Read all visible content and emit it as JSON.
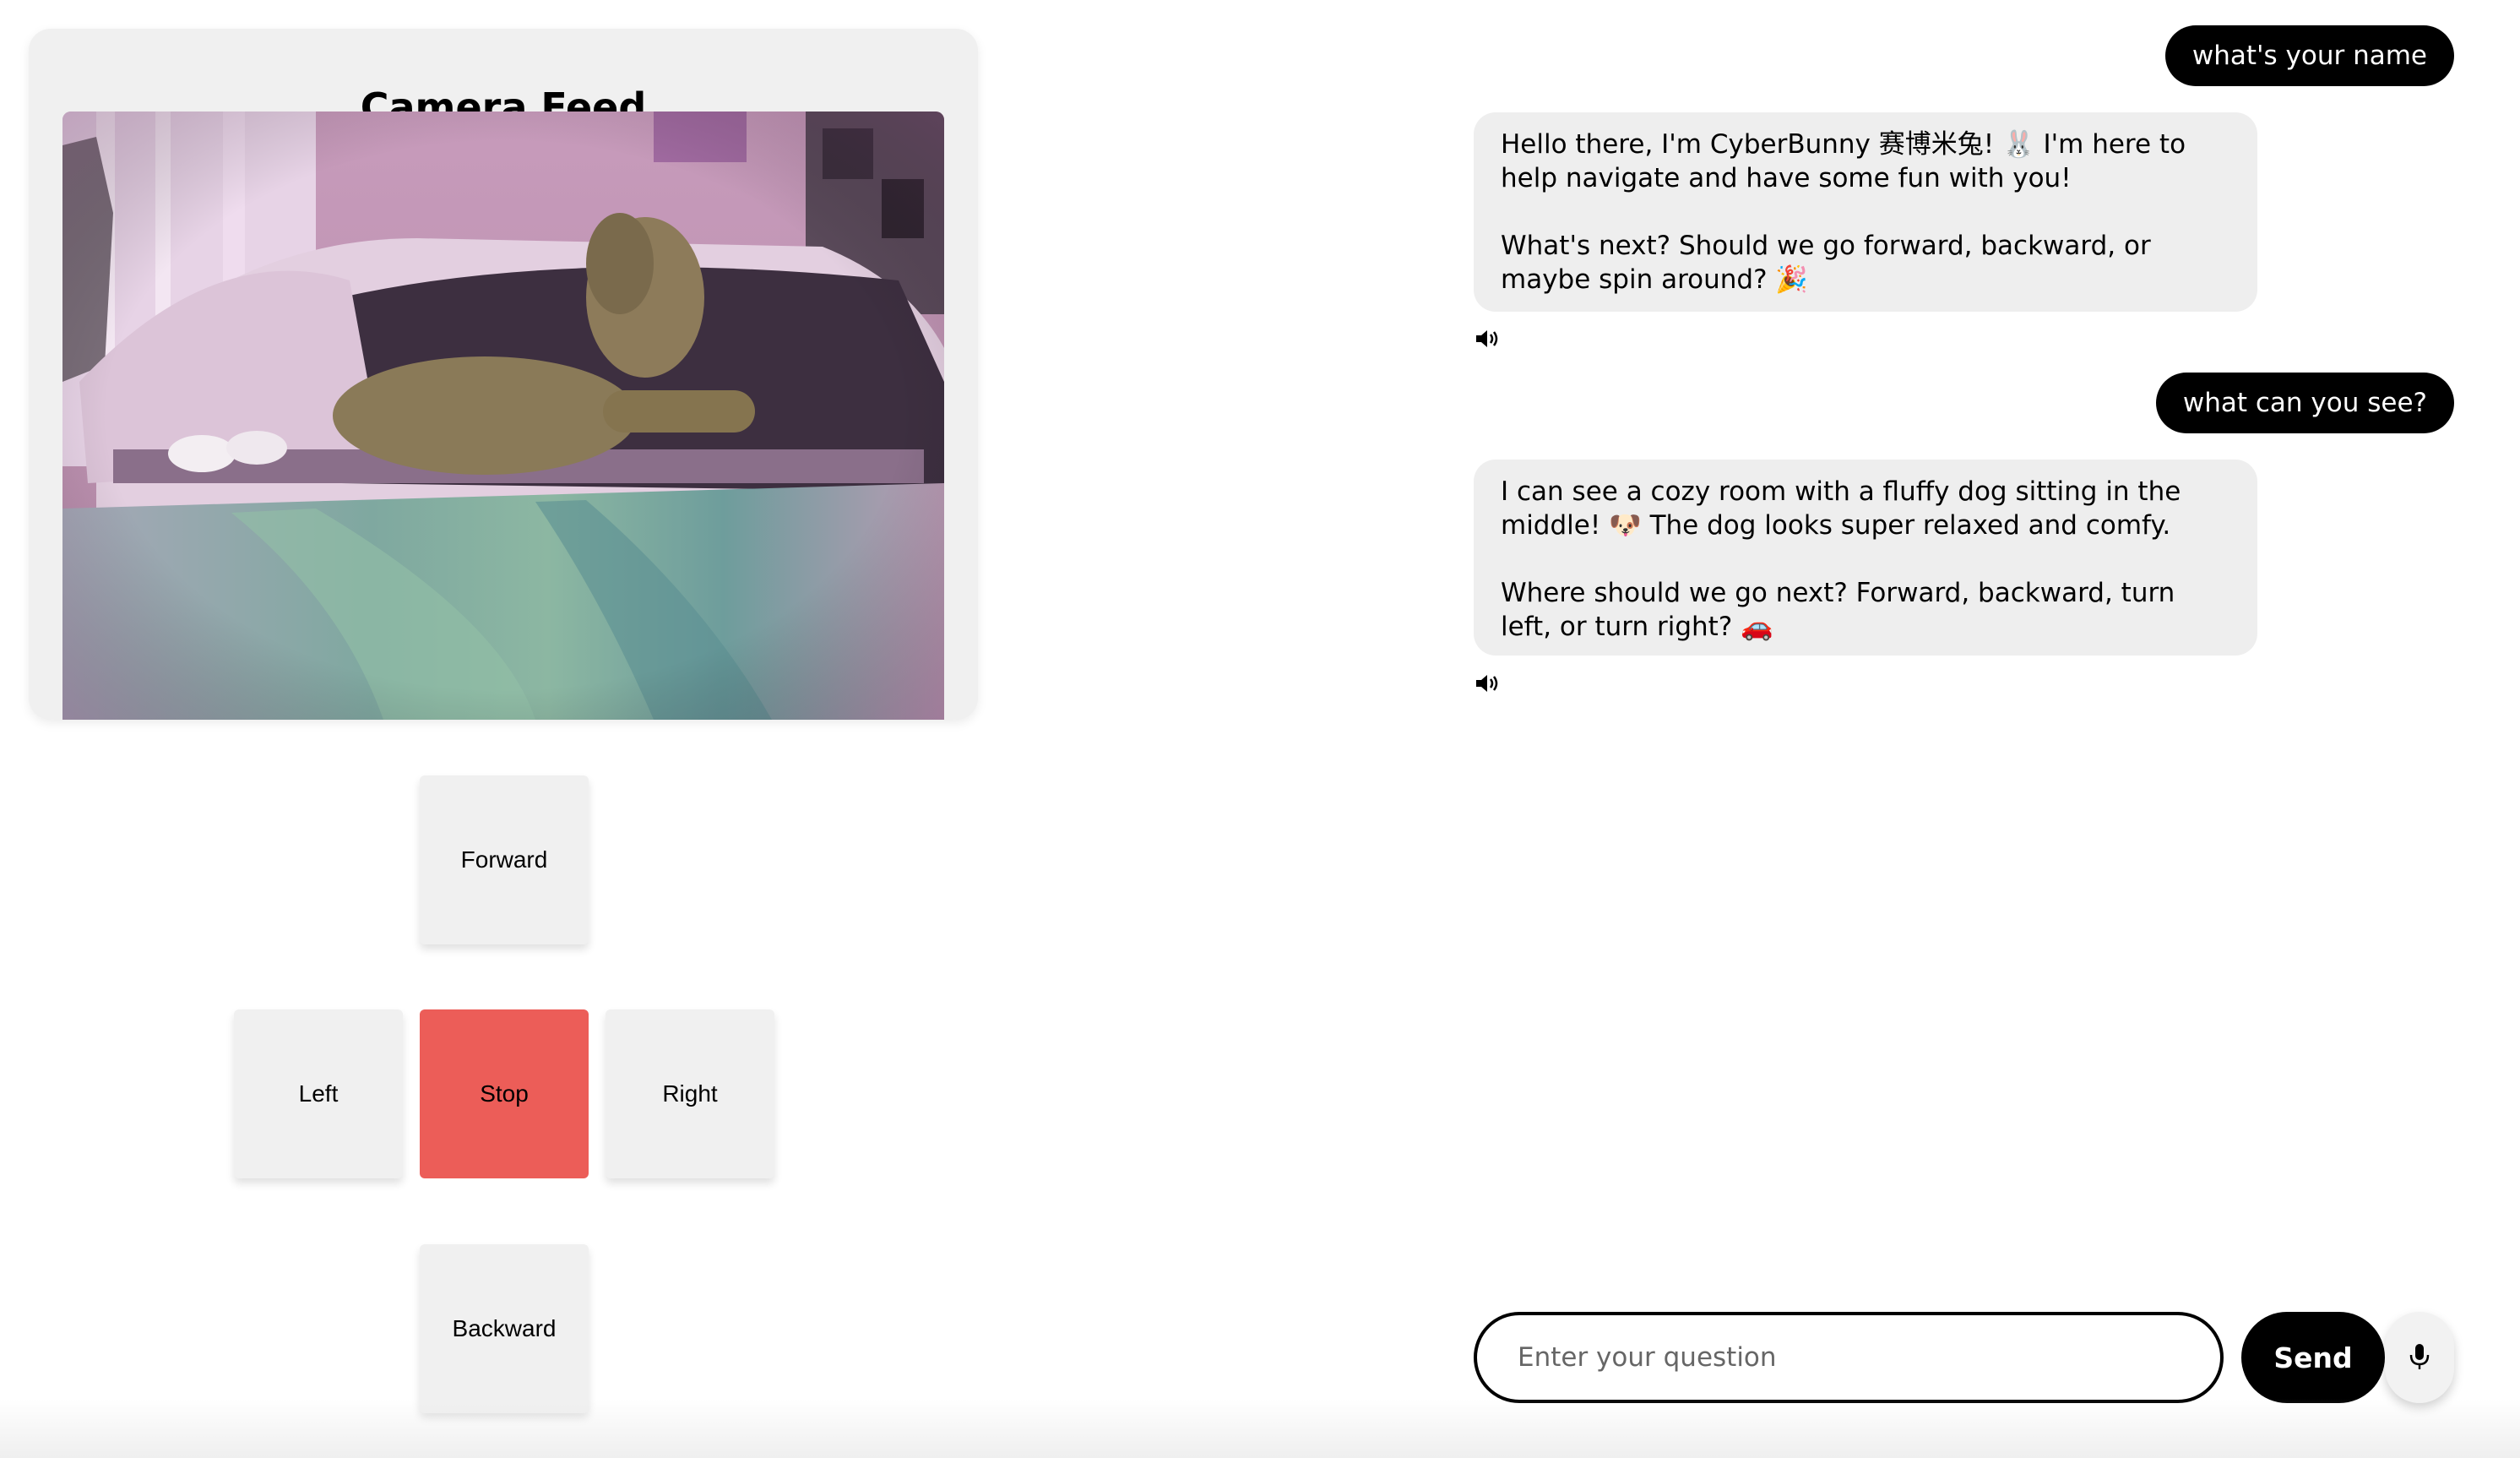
{
  "camera": {
    "title": "Camera Feed"
  },
  "controls": {
    "forward": "Forward",
    "left": "Left",
    "stop": "Stop",
    "right": "Right",
    "backward": "Backward"
  },
  "chat": {
    "messages": [
      {
        "role": "user",
        "text": "what's your name"
      },
      {
        "role": "assistant",
        "paragraphs": [
          "Hello there, I'm CyberBunny 赛博米兔! 🐰 I'm here to help navigate and have some fun with you!",
          "What's next? Should we go forward, backward, or maybe spin around? 🎉"
        ]
      },
      {
        "role": "user",
        "text": "what can you see?"
      },
      {
        "role": "assistant",
        "paragraphs": [
          "I can see a cozy room with a fluffy dog sitting in the middle! 🐶 The dog looks super relaxed and comfy.",
          "Where should we go next? Forward, backward, turn left, or turn right? 🚗"
        ]
      }
    ]
  },
  "input": {
    "placeholder": "Enter your question",
    "value": ""
  },
  "buttons": {
    "send": "Send"
  },
  "icons": {
    "speaker": "speaker-icon",
    "mic": "microphone-icon"
  },
  "colors": {
    "stop_button": "#ec5d58",
    "user_bubble": "#000000",
    "assistant_bubble": "#eeeeee",
    "panel_bg": "#f0f0f0"
  }
}
